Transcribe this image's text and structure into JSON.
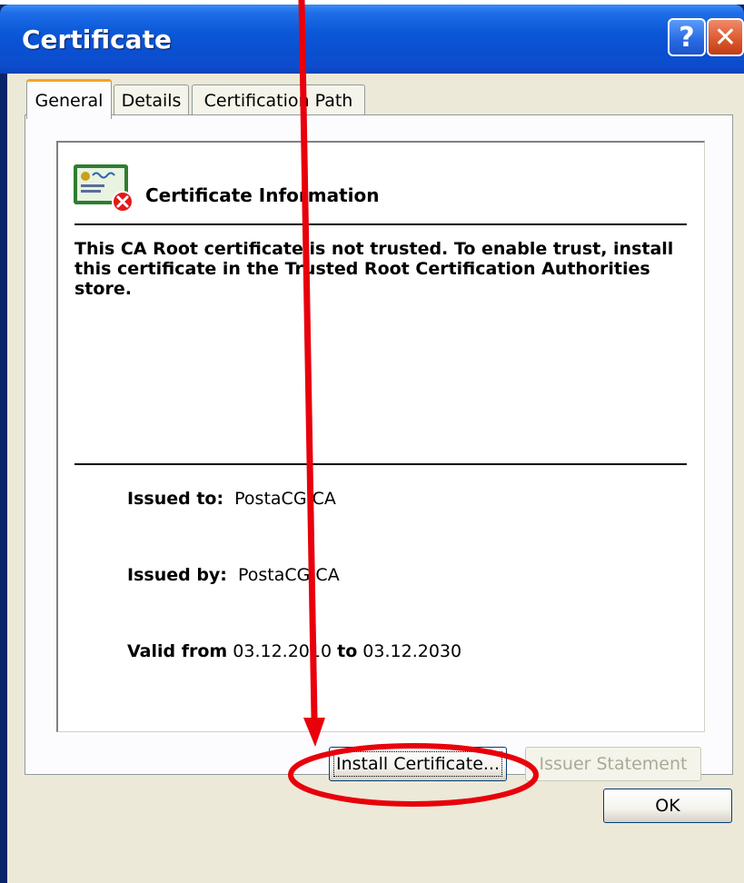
{
  "window": {
    "title": "Certificate",
    "help_glyph": "?",
    "close_glyph": "✕"
  },
  "tabs": [
    {
      "label": "General",
      "active": true
    },
    {
      "label": "Details",
      "active": false
    },
    {
      "label": "Certification Path",
      "active": false
    }
  ],
  "general": {
    "section_title": "Certificate Information",
    "warning_text": "This CA Root certificate is not trusted. To enable trust, install this certificate in the Trusted Root Certification Authorities store.",
    "issued_to_label": "Issued to:",
    "issued_to_value": "PostaCG CA",
    "issued_by_label": "Issued by:",
    "issued_by_value": "PostaCG CA",
    "valid_from_label": "Valid from",
    "valid_from_value": "03.12.2010",
    "valid_to_label": "to",
    "valid_to_value": "03.12.2030"
  },
  "buttons": {
    "install": "Install Certificate...",
    "issuer_statement": "Issuer Statement",
    "ok": "OK"
  },
  "icons": {
    "certificate_icon": "certificate-error-icon",
    "error_badge": "red-x-icon"
  },
  "annotation": {
    "arrow_color": "#e8000b",
    "ellipse_color": "#e8000b"
  }
}
